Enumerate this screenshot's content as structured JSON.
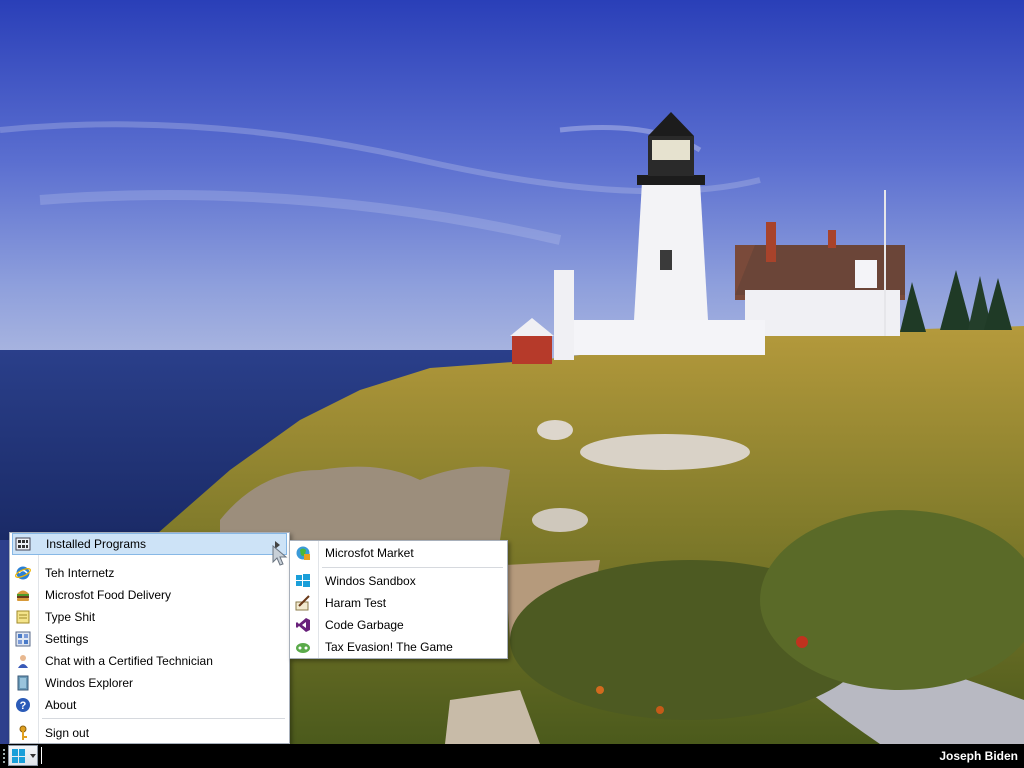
{
  "taskbar": {
    "start_label": "",
    "user_name": "Joseph Biden"
  },
  "start_menu": {
    "items": [
      {
        "label": "Installed Programs",
        "icon": "programs-icon"
      },
      {
        "label": "Teh Internetz",
        "icon": "ie-globe-icon"
      },
      {
        "label": "Microsfot Food Delivery",
        "icon": "burger-icon"
      },
      {
        "label": "Type Shit",
        "icon": "notepad-icon"
      },
      {
        "label": "Settings",
        "icon": "settings-icon"
      },
      {
        "label": "Chat with a Certified Technician",
        "icon": "technician-icon"
      },
      {
        "label": "Windos Explorer",
        "icon": "explorer-icon"
      },
      {
        "label": "About",
        "icon": "help-icon"
      },
      {
        "label": "Sign out",
        "icon": "key-icon"
      }
    ]
  },
  "submenu": {
    "items": [
      {
        "label": "Microsfot Market",
        "icon": "market-globe-icon"
      },
      {
        "label": "Windos Sandbox",
        "icon": "windows-logo-icon"
      },
      {
        "label": "Haram Test",
        "icon": "pen-paper-icon"
      },
      {
        "label": "Code Garbage",
        "icon": "visual-studio-icon"
      },
      {
        "label": "Tax Evasion! The Game",
        "icon": "game-icon"
      }
    ]
  },
  "colors": {
    "menu_highlight": "#cde3f7",
    "taskbar": "#000000",
    "accent": "#1a9fd9"
  }
}
